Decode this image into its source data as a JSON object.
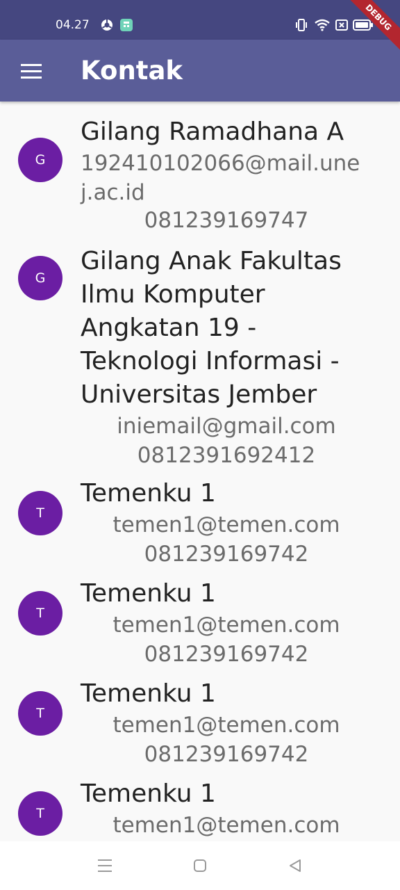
{
  "status_bar": {
    "time": "04.27"
  },
  "app_bar": {
    "title": "Kontak",
    "debug_banner": "DEBUG"
  },
  "contacts": [
    {
      "initial": "G",
      "name": "Gilang Ramadhana A",
      "email": "192410102066@mail.unej.ac.id",
      "phone": "081239169747"
    },
    {
      "initial": "G",
      "name": "Gilang Anak Fakultas Ilmu Komputer Angkatan 19 - Teknologi Informasi - Universitas Jember",
      "email": "iniemail@gmail.com",
      "phone": "0812391692412"
    },
    {
      "initial": "T",
      "name": "Temenku 1",
      "email": "temen1@temen.com",
      "phone": "081239169742"
    },
    {
      "initial": "T",
      "name": "Temenku 1",
      "email": "temen1@temen.com",
      "phone": "081239169742"
    },
    {
      "initial": "T",
      "name": "Temenku 1",
      "email": "temen1@temen.com",
      "phone": "081239169742"
    },
    {
      "initial": "T",
      "name": "Temenku 1",
      "email": "temen1@temen.com",
      "phone": ""
    }
  ],
  "colors": {
    "status_bar": "#454780",
    "app_bar": "#5a5d98",
    "avatar": "#6b1ea3",
    "debug": "#b3262f"
  },
  "icons": [
    "browser-icon",
    "calculator-icon",
    "vibrate-icon",
    "wifi-icon",
    "sim-icon",
    "battery-icon",
    "menu-icon",
    "nav-recents-icon",
    "nav-home-icon",
    "nav-back-icon"
  ]
}
